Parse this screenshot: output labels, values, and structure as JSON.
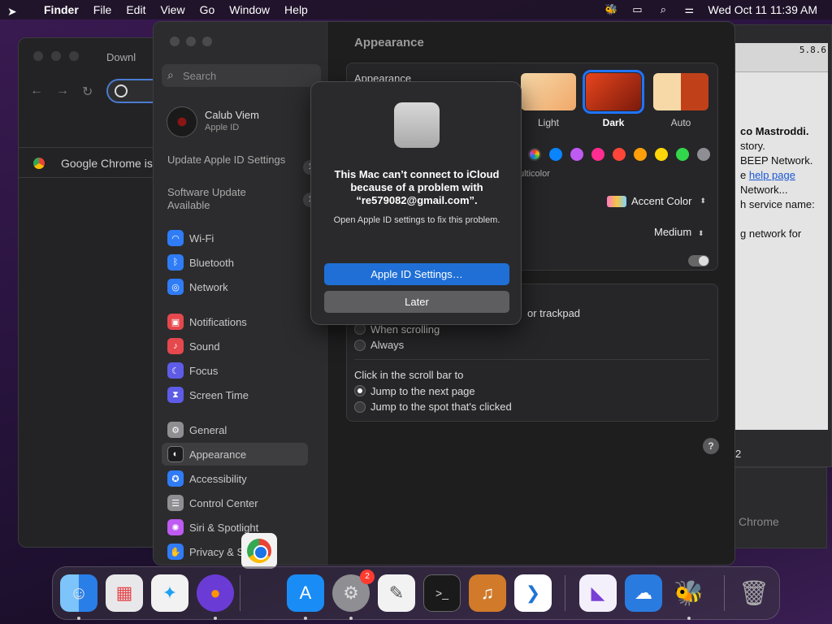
{
  "menubar": {
    "items": [
      "Finder",
      "File",
      "Edit",
      "View",
      "Go",
      "Window",
      "Help"
    ],
    "clock": "Wed Oct 11  11:39 AM",
    "icons": [
      "bee-icon",
      "window-icon",
      "search-icon",
      "control-center-icon"
    ]
  },
  "chrome_window": {
    "tab_title": "Downl",
    "infobar_text": "Google Chrome isn"
  },
  "right_window": {
    "version": "5.8.6",
    "lines": [
      "co Mastroddi.",
      "story.",
      "BEEP Network.",
      "e ",
      "help page",
      "Network...",
      "h service name:",
      "g network for"
    ],
    "status": "2",
    "dock_label": "Chrome"
  },
  "settings": {
    "search_placeholder": "Search",
    "account": {
      "name": "Calub Viem",
      "sub": "Apple ID"
    },
    "updates": [
      {
        "label": "Update Apple ID Settings",
        "count": "1"
      },
      {
        "label": "Software Update Available",
        "count": "1"
      }
    ],
    "sidebar": [
      {
        "label": "Wi-Fi",
        "icon": "wifi-icon",
        "color": "#2f7cf6"
      },
      {
        "label": "Bluetooth",
        "icon": "bluetooth-icon",
        "color": "#2f7cf6"
      },
      {
        "label": "Network",
        "icon": "globe-icon",
        "color": "#2f7cf6"
      },
      {
        "label": "Notifications",
        "icon": "bell-icon",
        "color": "#e5484d"
      },
      {
        "label": "Sound",
        "icon": "speaker-icon",
        "color": "#e5484d"
      },
      {
        "label": "Focus",
        "icon": "moon-icon",
        "color": "#5e5ce6"
      },
      {
        "label": "Screen Time",
        "icon": "hourglass-icon",
        "color": "#5e5ce6"
      },
      {
        "label": "General",
        "icon": "gear-icon",
        "color": "#8e8e93"
      },
      {
        "label": "Appearance",
        "icon": "appearance-icon",
        "color": "#1c1c1e"
      },
      {
        "label": "Accessibility",
        "icon": "accessibility-icon",
        "color": "#2f7cf6"
      },
      {
        "label": "Control Center",
        "icon": "control-center-icon",
        "color": "#8e8e93"
      },
      {
        "label": "Siri & Spotlight",
        "icon": "siri-icon",
        "color": "#bf5af2"
      },
      {
        "label": "Privacy & S",
        "icon": "hand-icon",
        "color": "#2f7cf6"
      }
    ],
    "page_title": "Appearance",
    "appearance_label": "Appearance",
    "themes": [
      {
        "label": "Light",
        "selected": false
      },
      {
        "label": "Dark",
        "selected": true
      },
      {
        "label": "Auto",
        "selected": false
      }
    ],
    "accent_colors": [
      "#0a84ff",
      "#bf5af2",
      "#ff2d91",
      "#ff453a",
      "#ff9f0a",
      "#ffd60a",
      "#32d74b",
      "#8e8e93"
    ],
    "multicolor_label": "ulticolor",
    "highlight_value": "Accent Color",
    "sidebar_size_value": "Medium",
    "scroll_partial_label": "or trackpad",
    "scroll_options": [
      "When scrolling",
      "Always"
    ],
    "click_label": "Click in the scroll bar to",
    "click_options": [
      "Jump to the next page",
      "Jump to the spot that's clicked"
    ],
    "help": "?"
  },
  "alert": {
    "message": "This Mac can’t connect to iCloud because of a problem with “re579082@gmail.com”.",
    "sub": "Open Apple ID settings to fix this problem.",
    "primary_button": "Apple ID Settings…",
    "secondary_button": "Later"
  },
  "dock": {
    "apps": [
      {
        "name": "Finder",
        "icon": "finder-icon",
        "color": "#2a8ff0"
      },
      {
        "name": "Launchpad",
        "icon": "launchpad-icon",
        "color": "#e8e8ea"
      },
      {
        "name": "Safari",
        "icon": "safari-icon",
        "color": "#1ea0f2"
      },
      {
        "name": "Firefox",
        "icon": "firefox-icon",
        "color": "#6b3bd6"
      },
      {
        "name": "App Store",
        "icon": "app-store-icon",
        "color": "#1a8cf5"
      },
      {
        "name": "System Settings",
        "icon": "gear-icon",
        "color": "#8e8e93",
        "badge": "2"
      },
      {
        "name": "TextEdit",
        "icon": "textedit-icon",
        "color": "#f2f2f2"
      },
      {
        "name": "Terminal",
        "icon": "terminal-icon",
        "color": "#1a1a1a"
      },
      {
        "name": "GarageBand",
        "icon": "guitar-icon",
        "color": "#d07a2a"
      },
      {
        "name": "Visual Studio Code",
        "icon": "vscode-icon",
        "color": "#ffffff"
      },
      {
        "name": "Visual Studio",
        "icon": "visual-studio-icon",
        "color": "#f3f0fb"
      },
      {
        "name": "Weather",
        "icon": "weather-icon",
        "color": "#2a7be0"
      },
      {
        "name": "BeeBEEP",
        "icon": "bee-icon",
        "color": "#f1c232"
      },
      {
        "name": "Trash",
        "icon": "trash-icon",
        "color": "#6d6d6f"
      }
    ]
  }
}
